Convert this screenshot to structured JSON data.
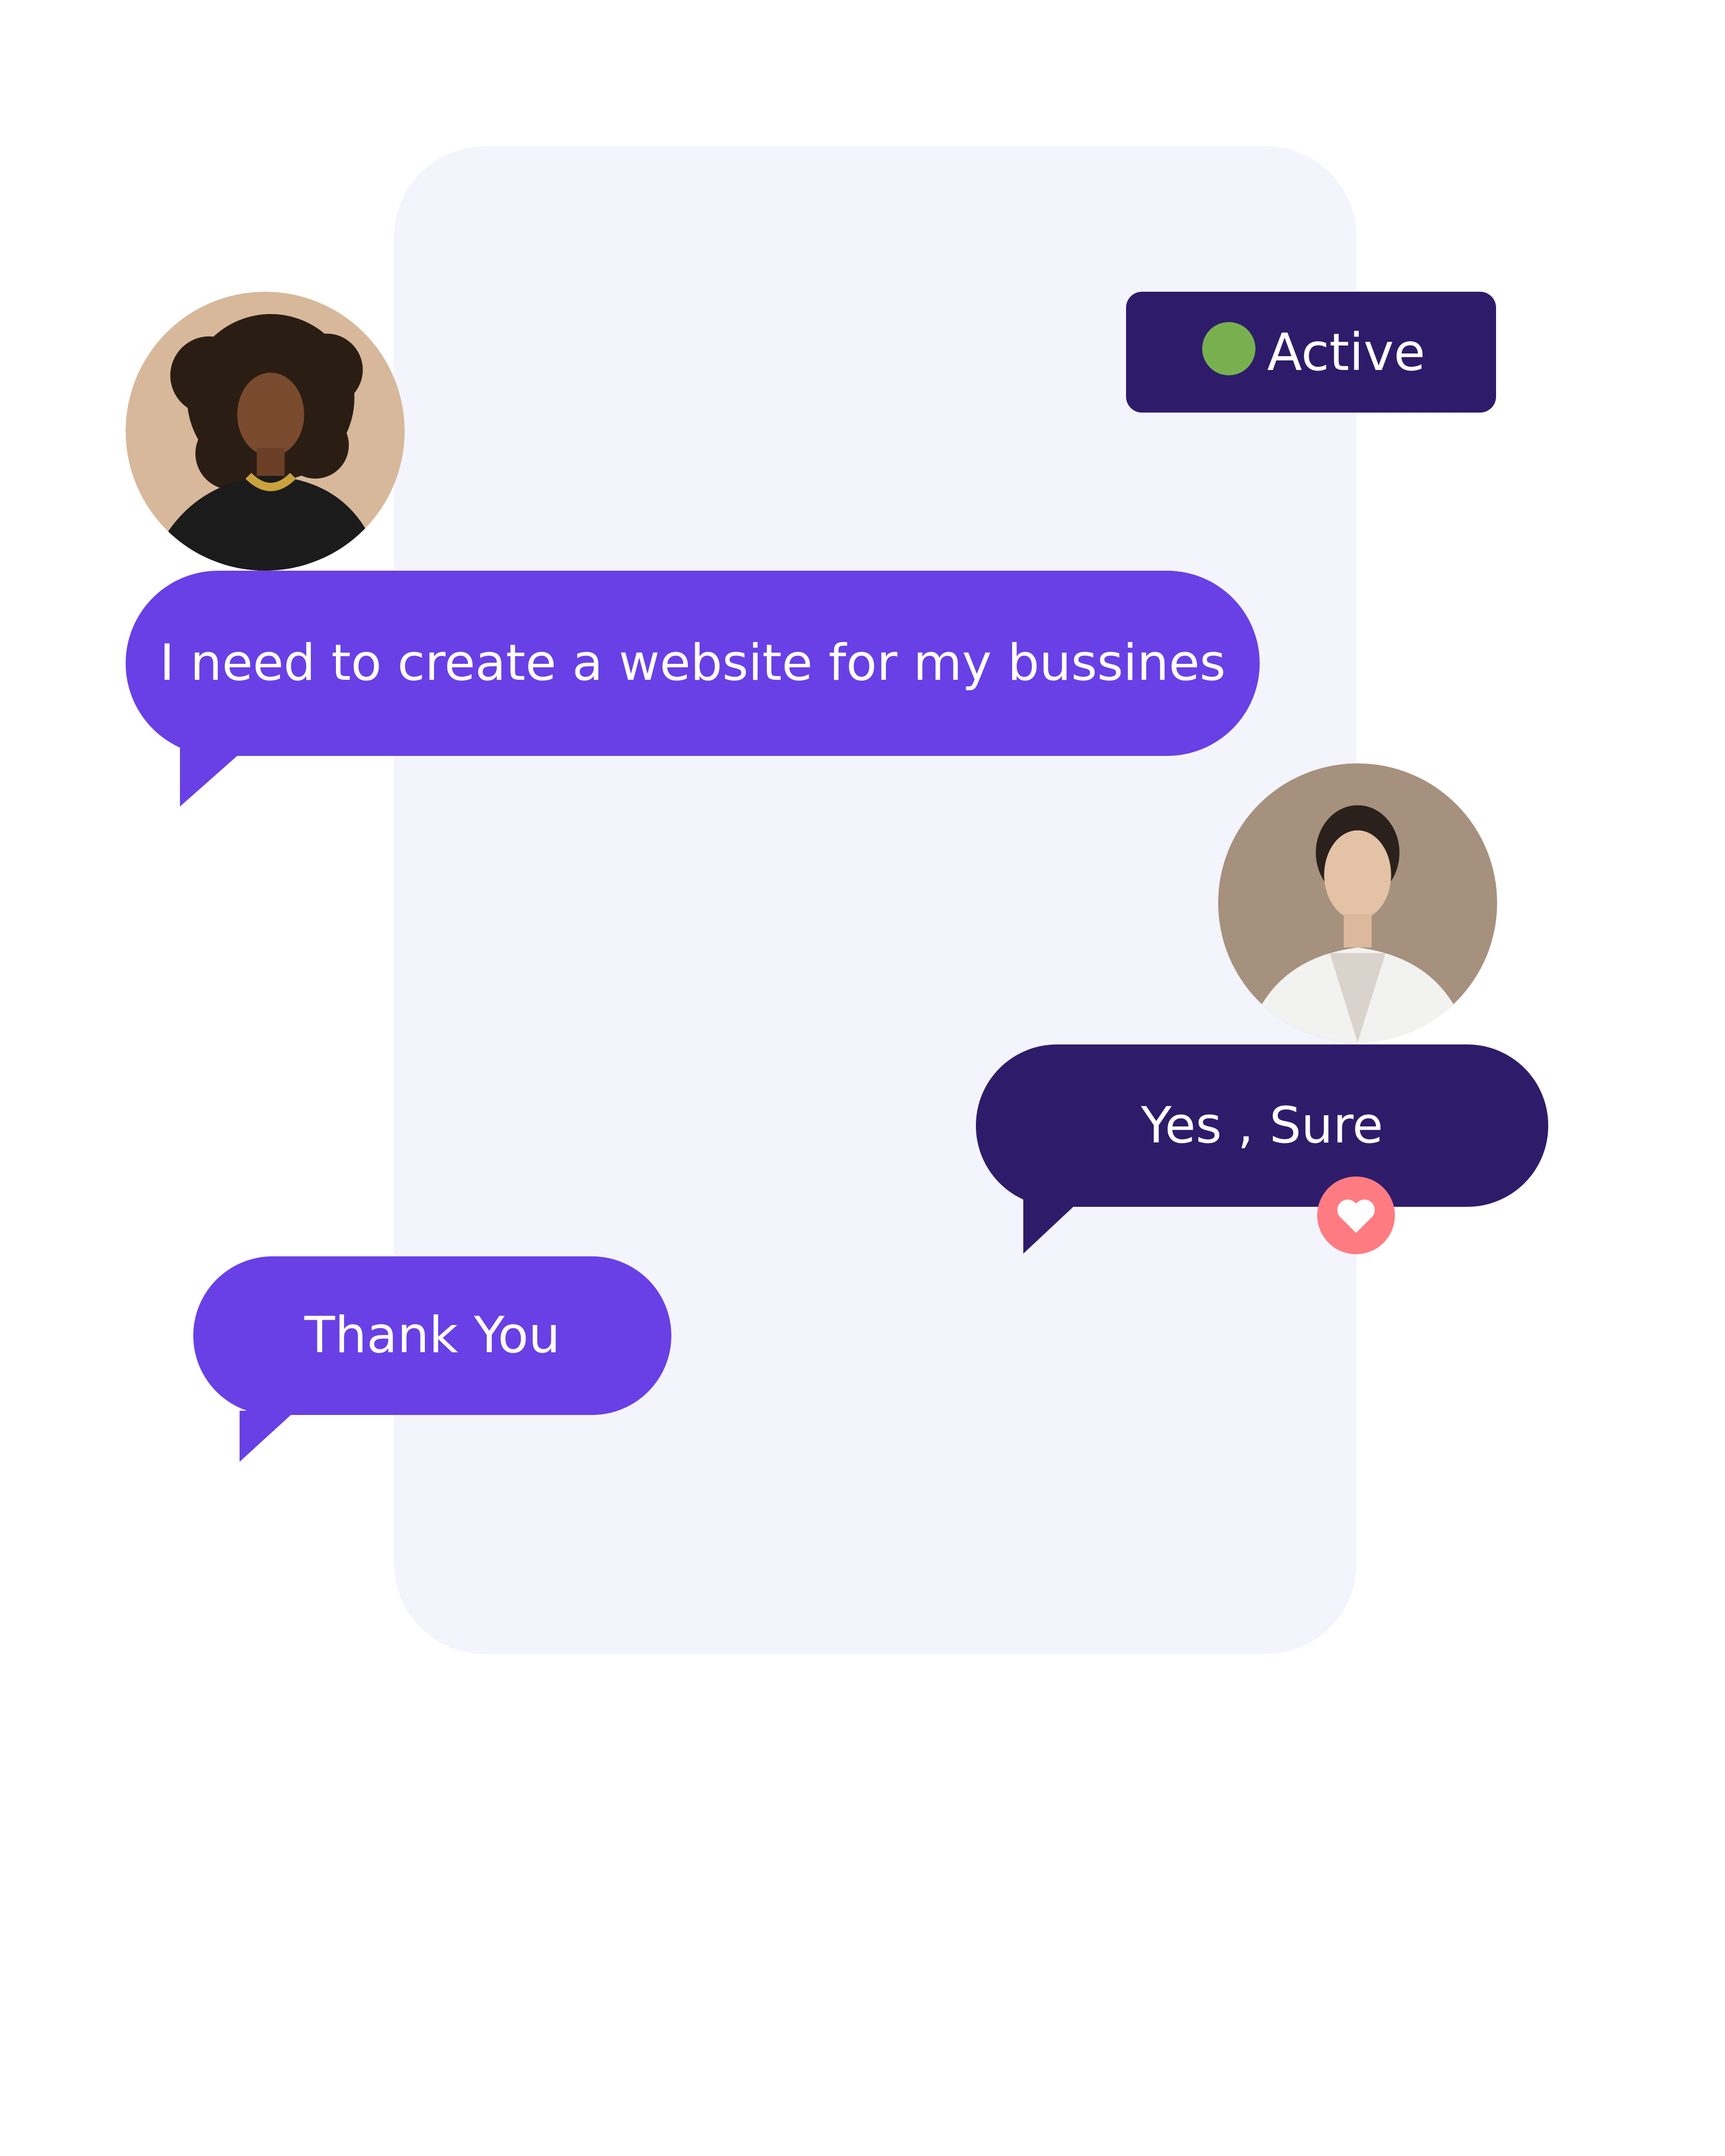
{
  "status": {
    "label": "Active",
    "dot_color": "#79b04f"
  },
  "messages": [
    {
      "sender": "left",
      "text": "I need to create a website for my bussines"
    },
    {
      "sender": "right",
      "text": "Yes , Sure",
      "reaction": "heart-icon"
    },
    {
      "sender": "left",
      "text": "Thank You"
    }
  ],
  "colors": {
    "incoming_bubble": "#6840e5",
    "outgoing_bubble": "#2e1c6b",
    "panel": "#f4f4fd",
    "reaction": "#ff7b82"
  }
}
